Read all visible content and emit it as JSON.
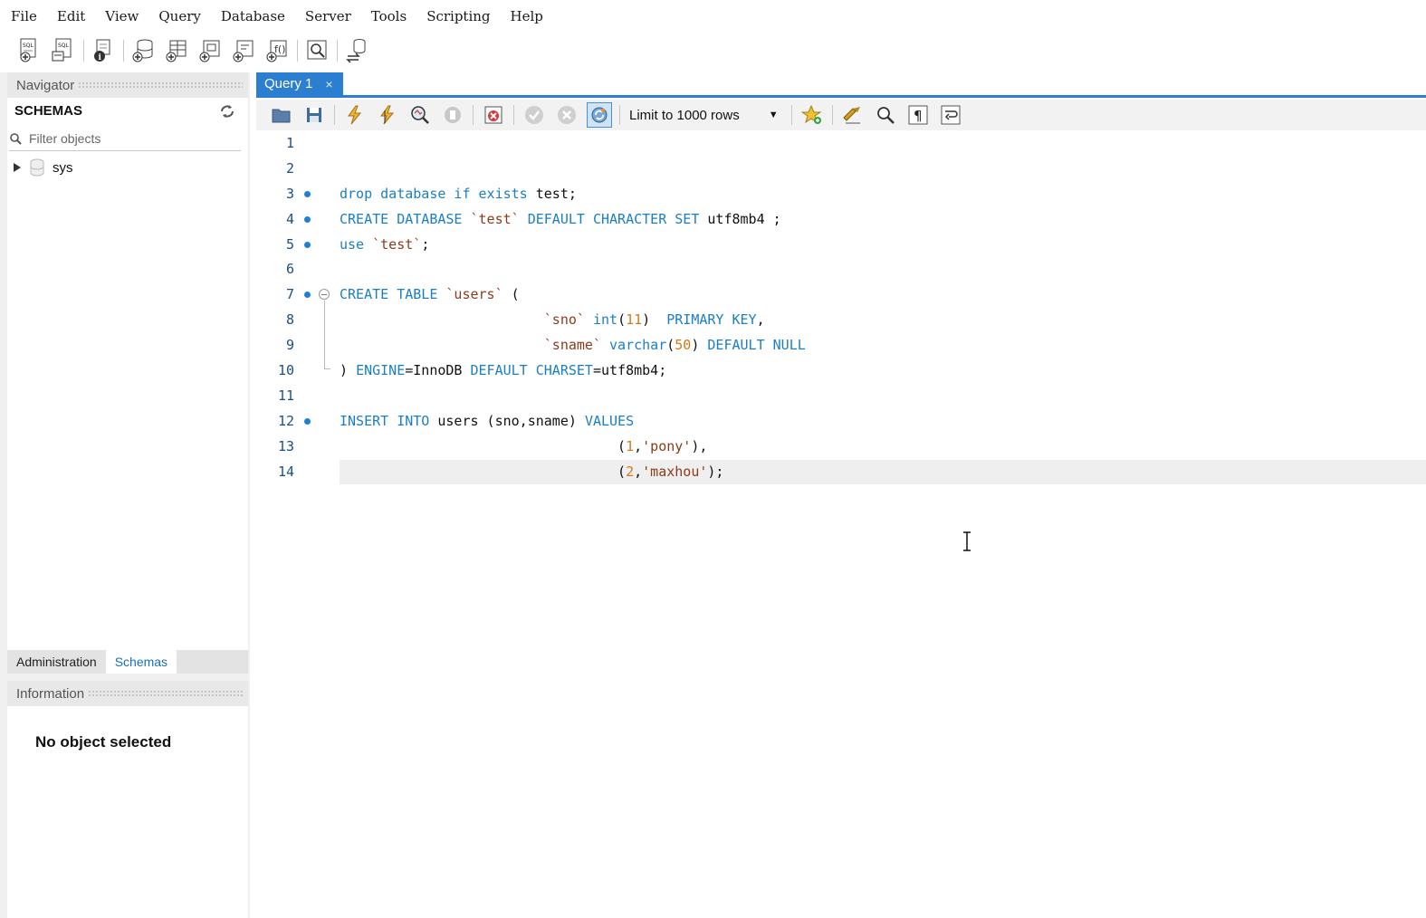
{
  "menu": [
    "File",
    "Edit",
    "View",
    "Query",
    "Database",
    "Server",
    "Tools",
    "Scripting",
    "Help"
  ],
  "main_toolbar_icons": [
    "new-sql-tab-icon",
    "open-sql-script-icon",
    "inspector-icon",
    "create-schema-icon",
    "create-table-icon",
    "create-view-icon",
    "create-procedure-icon",
    "create-function-icon",
    "search-table-data-icon",
    "reconnect-icon"
  ],
  "navigator": {
    "header": "Navigator",
    "schemas_title": "SCHEMAS",
    "filter_placeholder": "Filter objects",
    "tree": [
      {
        "label": "sys",
        "expanded": false
      }
    ]
  },
  "bottom_tabs": {
    "administration": "Administration",
    "schemas": "Schemas",
    "active": "Schemas"
  },
  "information": {
    "header": "Information",
    "message": "No object selected"
  },
  "query_tab": {
    "label": "Query 1",
    "close": "×"
  },
  "sql_toolbar": {
    "icons": [
      "open-file-icon",
      "save-icon",
      "execute-icon",
      "execute-current-icon",
      "explain-icon",
      "stop-icon",
      "toggle-error-icon",
      "commit-icon",
      "rollback-icon",
      "autocommit-icon",
      "bookmark-icon",
      "beautify-icon",
      "find-icon",
      "invisible-chars-icon",
      "wrap-icon"
    ],
    "limit_label": "Limit to 1000 rows"
  },
  "editor": {
    "current_line": 14,
    "lines": [
      {
        "n": "1",
        "tokens": []
      },
      {
        "n": "2",
        "tokens": []
      },
      {
        "n": "3",
        "marker": true,
        "tokens": [
          {
            "t": "kw",
            "v": "drop database if exists"
          },
          {
            "t": "txt",
            "v": " test;"
          }
        ]
      },
      {
        "n": "4",
        "marker": true,
        "tokens": [
          {
            "t": "kw",
            "v": "CREATE DATABASE"
          },
          {
            "t": "txt",
            "v": " "
          },
          {
            "t": "str",
            "v": "`test`"
          },
          {
            "t": "txt",
            "v": " "
          },
          {
            "t": "kw",
            "v": "DEFAULT CHARACTER SET"
          },
          {
            "t": "txt",
            "v": " utf8mb4 ;"
          }
        ]
      },
      {
        "n": "5",
        "marker": true,
        "tokens": [
          {
            "t": "kw",
            "v": "use"
          },
          {
            "t": "txt",
            "v": " "
          },
          {
            "t": "str",
            "v": "`test`"
          },
          {
            "t": "txt",
            "v": ";"
          }
        ]
      },
      {
        "n": "6",
        "tokens": []
      },
      {
        "n": "7",
        "marker": true,
        "fold": "start",
        "tokens": [
          {
            "t": "kw",
            "v": "CREATE TABLE"
          },
          {
            "t": "txt",
            "v": " "
          },
          {
            "t": "str",
            "v": "`users`"
          },
          {
            "t": "txt",
            "v": " ("
          }
        ]
      },
      {
        "n": "8",
        "fold": "mid",
        "tokens": [
          {
            "t": "txt",
            "v": "                         "
          },
          {
            "t": "str",
            "v": "`sno`"
          },
          {
            "t": "txt",
            "v": " "
          },
          {
            "t": "kw",
            "v": "int"
          },
          {
            "t": "txt",
            "v": "("
          },
          {
            "t": "num",
            "v": "11"
          },
          {
            "t": "txt",
            "v": ")  "
          },
          {
            "t": "kw",
            "v": "PRIMARY KEY"
          },
          {
            "t": "txt",
            "v": ","
          }
        ]
      },
      {
        "n": "9",
        "fold": "mid",
        "tokens": [
          {
            "t": "txt",
            "v": "                         "
          },
          {
            "t": "str",
            "v": "`sname`"
          },
          {
            "t": "txt",
            "v": " "
          },
          {
            "t": "kw",
            "v": "varchar"
          },
          {
            "t": "txt",
            "v": "("
          },
          {
            "t": "num",
            "v": "50"
          },
          {
            "t": "txt",
            "v": ") "
          },
          {
            "t": "kw",
            "v": "DEFAULT NULL"
          }
        ]
      },
      {
        "n": "10",
        "fold": "end",
        "tokens": [
          {
            "t": "txt",
            "v": ") "
          },
          {
            "t": "kw",
            "v": "ENGINE"
          },
          {
            "t": "txt",
            "v": "=InnoDB "
          },
          {
            "t": "kw",
            "v": "DEFAULT CHARSET"
          },
          {
            "t": "txt",
            "v": "=utf8mb4;"
          }
        ]
      },
      {
        "n": "11",
        "tokens": []
      },
      {
        "n": "12",
        "marker": true,
        "tokens": [
          {
            "t": "kw",
            "v": "INSERT INTO"
          },
          {
            "t": "txt",
            "v": " users (sno,sname) "
          },
          {
            "t": "kw",
            "v": "VALUES"
          }
        ]
      },
      {
        "n": "13",
        "tokens": [
          {
            "t": "txt",
            "v": "                                  ("
          },
          {
            "t": "num",
            "v": "1"
          },
          {
            "t": "txt",
            "v": ","
          },
          {
            "t": "str",
            "v": "'pony'"
          },
          {
            "t": "txt",
            "v": "),"
          }
        ]
      },
      {
        "n": "14",
        "tokens": [
          {
            "t": "txt",
            "v": "                                  ("
          },
          {
            "t": "num",
            "v": "2"
          },
          {
            "t": "txt",
            "v": ","
          },
          {
            "t": "str",
            "v": "'maxhou'"
          },
          {
            "t": "txt",
            "v": ");"
          }
        ]
      }
    ]
  },
  "colors": {
    "accent": "#2c7fd0",
    "keyword": "#1a7fc4",
    "string": "#8b3b1a",
    "number": "#d07a1a",
    "line_number": "#1a4f88"
  }
}
